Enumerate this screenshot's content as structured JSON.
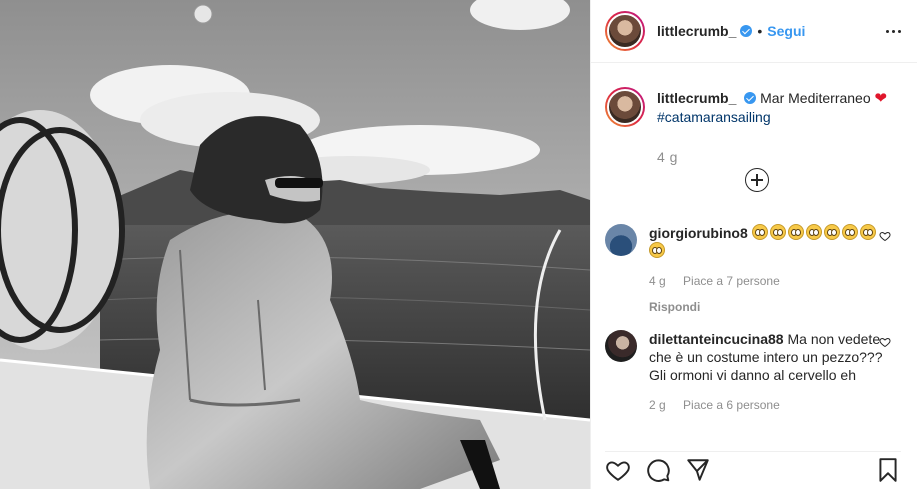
{
  "header": {
    "username": "littlecrumb_",
    "separator": "•",
    "follow_label": "Segui"
  },
  "caption": {
    "username": "littlecrumb_",
    "text": "Mar Mediterraneo",
    "emoji": "❤",
    "hashtag": "#catamaransailing",
    "time": "4 g"
  },
  "comments": [
    {
      "username": "giorgiorubino8",
      "emoji_count": 8,
      "time": "4 g",
      "likes": "Piace a 7 persone",
      "reply": "Rispondi"
    },
    {
      "username": "dilettanteincucina88",
      "text": "Ma non vedete che è un costume intero un pezzo??? Gli ormoni vi danno al cervello eh",
      "time": "2 g",
      "likes": "Piace a 6 persone"
    }
  ],
  "icons": {
    "more": "more-options-icon",
    "load_more": "plus-circle-icon",
    "like": "heart-icon",
    "comment": "comment-icon",
    "share": "share-icon",
    "save": "bookmark-icon"
  },
  "colors": {
    "accent": "#3897f0",
    "hashtag": "#003569",
    "muted": "#8e8e8e",
    "heart": "#e0162b"
  }
}
